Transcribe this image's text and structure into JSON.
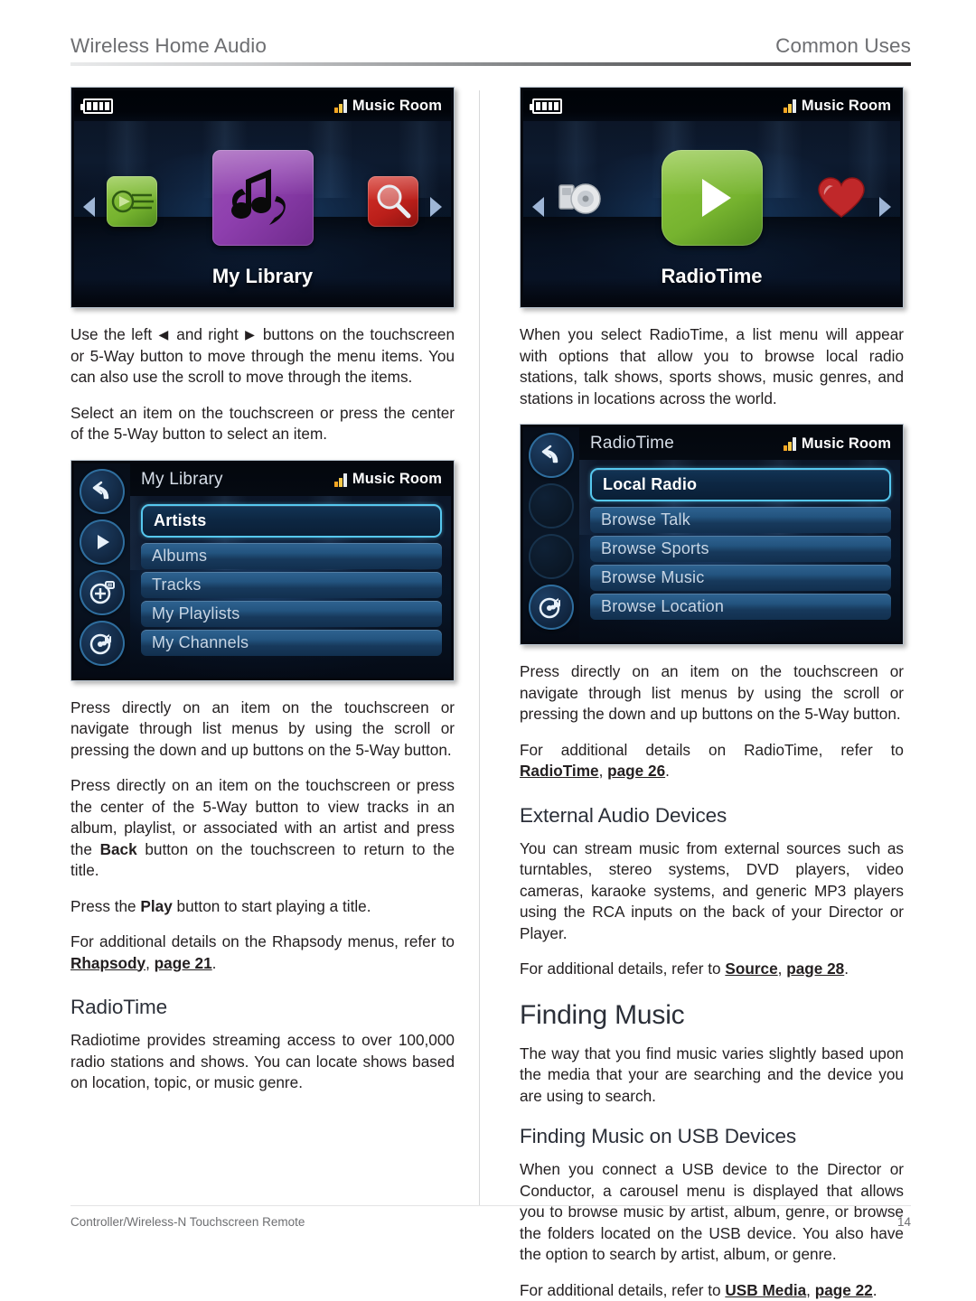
{
  "header": {
    "left_title": "Wireless Home Audio",
    "right_title": "Common Uses"
  },
  "footer": {
    "left": "Controller/Wireless-N Touchscreen Remote",
    "page_number": "14"
  },
  "colors": {
    "heading": "#2b2f38",
    "body": "#231f20",
    "header_gray": "#6d6e71",
    "screen_accent": "#56c8ef",
    "signal_amber": "#f5a623"
  },
  "left_column": {
    "carousel": {
      "battery_icon": "battery-icon",
      "signal_icon": "signal-bars-icon",
      "room_label": "Music Room",
      "left_arrow_icon": "arrow-left-icon",
      "right_arrow_icon": "arrow-right-icon",
      "side_left_icon": "playlist-icon",
      "center_icon": "my-library-music-note-icon",
      "side_right_icon": "search-magnifier-icon",
      "selected_label": "My Library"
    },
    "para_1": "Use the left  and right  buttons on the touchscreen or 5-Way button to move through the menu items. You can also use the scroll to move through the items.",
    "para_1_parts": {
      "a": "Use the left ",
      "b": " and right ",
      "c": " buttons on the touchscreen or 5-Way button to move through the menu items. You can also use the scroll to move through the items."
    },
    "para_2": "Select an item on the touchscreen or press the center of the 5-Way button to select an item.",
    "list_menu": {
      "title": "My Library",
      "room_label": "Music Room",
      "sidebar_icons": [
        "back-arrow-icon",
        "play-icon",
        "add-to-playlist-icon",
        "now-playing-turntable-icon"
      ],
      "items": [
        {
          "label": "Artists",
          "selected": true
        },
        {
          "label": "Albums",
          "selected": false
        },
        {
          "label": "Tracks",
          "selected": false
        },
        {
          "label": "My Playlists",
          "selected": false
        },
        {
          "label": "My Channels",
          "selected": false
        }
      ]
    },
    "para_3": "Press directly on an item on the touchscreen or navigate through list menus by using the scroll or pressing the down and up buttons on the 5-Way button.",
    "para_4_parts": {
      "a": "Press directly on an item on the touchscreen or press the center of the 5-Way button to view tracks in an album, playlist, or associated with an artist and press the ",
      "bold": "Back",
      "b": " button on the touchscreen to return to the title."
    },
    "para_5_parts": {
      "a": "Press the ",
      "bold": "Play",
      "b": "  button to start playing a title."
    },
    "para_6_parts": {
      "a": "For additional details on the Rhapsody menus, refer to ",
      "link1": "Rhapsody",
      "mid": ", ",
      "link2": "page 21",
      "b": "."
    },
    "heading_radiotime": "RadioTime",
    "para_7": "Radiotime provides streaming access to over 100,000 radio stations and shows. You can locate shows based on location, topic, or music genre."
  },
  "right_column": {
    "carousel": {
      "battery_icon": "battery-icon",
      "signal_icon": "signal-bars-icon",
      "room_label": "Music Room",
      "left_arrow_icon": "arrow-left-icon",
      "right_arrow_icon": "arrow-right-icon",
      "side_left_icon": "cd-disc-icon",
      "center_icon": "radiotime-play-icon",
      "side_right_icon": "favorites-heart-icon",
      "selected_label": "RadioTime"
    },
    "para_1": "When you select RadioTime, a list menu will appear with options that allow you to browse local radio stations, talk shows, sports shows, music genres, and stations in locations across the world.",
    "list_menu": {
      "title": "RadioTime",
      "room_label": "Music Room",
      "sidebar_icons": [
        "back-arrow-icon",
        "disabled-button-icon",
        "disabled-button-icon",
        "now-playing-turntable-icon"
      ],
      "items": [
        {
          "label": "Local Radio",
          "selected": true
        },
        {
          "label": "Browse Talk",
          "selected": false
        },
        {
          "label": "Browse Sports",
          "selected": false
        },
        {
          "label": "Browse Music",
          "selected": false
        },
        {
          "label": "Browse Location",
          "selected": false
        }
      ]
    },
    "para_2": "Press directly on an item on the touchscreen or navigate through list menus by using the scroll or pressing the down and up buttons on the 5-Way button.",
    "para_3_parts": {
      "a": "For additional details on RadioTime, refer to ",
      "link1": "RadioTime",
      "mid": ", ",
      "link2": "page 26",
      "b": "."
    },
    "heading_external": "External Audio Devices",
    "para_4": "You can stream music from external sources such as turntables, stereo systems, DVD players, video cameras, karaoke systems, and generic MP3 players using the RCA inputs on the back of your Director or Player.",
    "para_5_parts": {
      "a": "For additional details, refer to ",
      "link1": "Source",
      "mid": ", ",
      "link2": "page 28",
      "b": "."
    },
    "heading_finding_music": "Finding Music",
    "para_6": "The way that you find music varies slightly based upon the media that your are searching and the device you are using to search.",
    "heading_usb": "Finding Music on USB Devices",
    "para_7": "When you connect a USB device to the Director or Conductor, a carousel menu is displayed that allows you to browse music by artist, album, genre, or browse the folders located on the USB device. You also have the option to search by artist, album, or genre.",
    "para_8_parts": {
      "a": "For additional details, refer to ",
      "link1": "USB Media",
      "mid": ", ",
      "link2": "page 22",
      "b": "."
    }
  }
}
